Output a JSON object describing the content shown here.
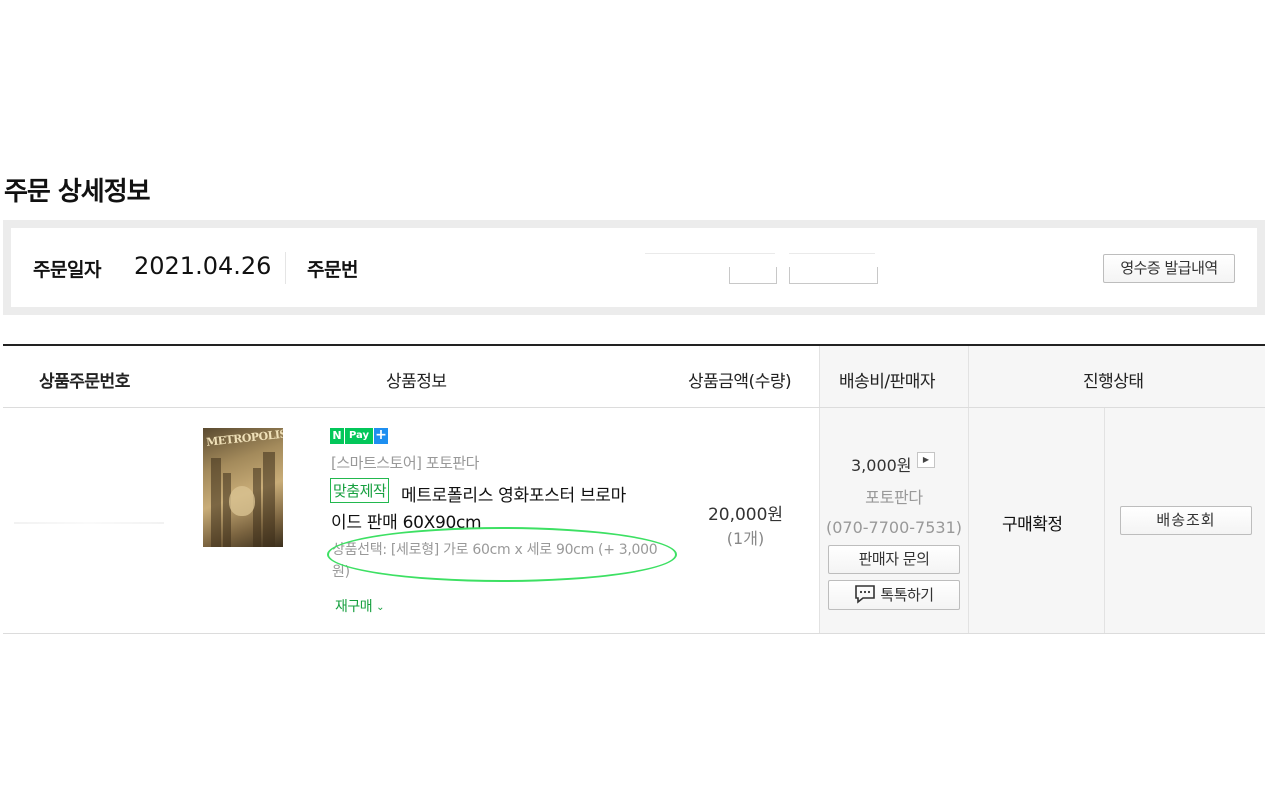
{
  "page": {
    "title": "주문 상세정보"
  },
  "summary": {
    "order_date_label": "주문일자",
    "order_date": "2021.04.26",
    "order_number_label": "주문번",
    "receipt_button": "영수증 발급내역"
  },
  "table": {
    "headers": {
      "product_order_no": "상품주문번호",
      "product_info": "상품정보",
      "price_qty": "상품금액(수량)",
      "shipping_seller": "배송비/판매자",
      "status": "진행상태"
    }
  },
  "item": {
    "npay_n": "N",
    "npay_pay": "Pay",
    "npay_plus": "+",
    "poster_text": "METROPOLIS",
    "store": "[스마트스토어] 포토판다",
    "custom_badge": "맞춤제작",
    "name_line1": "메트로폴리스 영화포스터 브로마",
    "name_line2_prefix": "이드 판매 ",
    "name_line2_size": "60X90cm",
    "option_text": "상품선택: [세로형] 가로 60cm x 세로 90cm (+ 3,000원)",
    "reorder": "재구매",
    "price": "20,000원",
    "quantity": "(1개)",
    "shipping_fee": "3,000원",
    "arrow_icon": "▶",
    "seller_name": "포토판다",
    "seller_phone": "(070-7700-7531)",
    "seller_inquiry_button": "판매자 문의",
    "talktalk_button": "톡톡하기",
    "status": "구매확정",
    "track_button": "배송조회"
  },
  "colors": {
    "accent_green": "#18a040",
    "highlight_ellipse": "#3de063",
    "npay_green": "#03c75a",
    "npay_blue": "#1e8ff0"
  }
}
